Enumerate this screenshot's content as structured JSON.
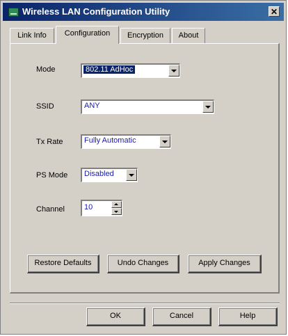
{
  "window": {
    "title": "Wireless LAN Configuration Utility",
    "close_symbol": "✕"
  },
  "tabs": [
    {
      "label": "Link Info",
      "active": false
    },
    {
      "label": "Configuration",
      "active": true
    },
    {
      "label": "Encryption",
      "active": false
    },
    {
      "label": "About",
      "active": false
    }
  ],
  "form": {
    "mode": {
      "label": "Mode",
      "value": "802.11 AdHoc"
    },
    "ssid": {
      "label": "SSID",
      "value": "ANY"
    },
    "tx_rate": {
      "label": "Tx Rate",
      "value": "Fully Automatic"
    },
    "ps_mode": {
      "label": "PS Mode",
      "value": "Disabled"
    },
    "channel": {
      "label": "Channel",
      "value": "10"
    }
  },
  "actions": {
    "restore_defaults": "Restore Defaults",
    "undo_changes": "Undo Changes",
    "apply_changes": "Apply Changes"
  },
  "dialog_buttons": {
    "ok": "OK",
    "cancel": "Cancel",
    "help": "Help"
  },
  "icons": [
    "app-icon",
    "close-icon",
    "dropdown-arrow-icon",
    "spin-up-icon",
    "spin-down-icon"
  ]
}
